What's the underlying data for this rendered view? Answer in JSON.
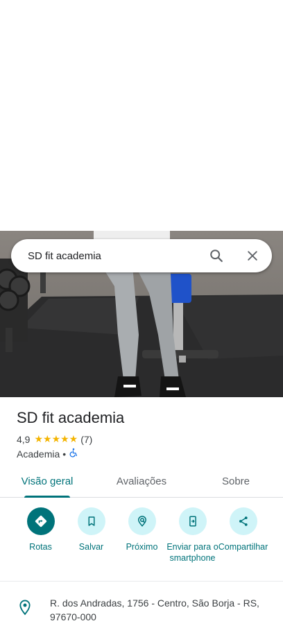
{
  "search": {
    "query": "SD fit academia"
  },
  "place": {
    "title": "SD fit academia",
    "rating": "4,9",
    "stars": "★★★★★",
    "review_count": "(7)",
    "category": "Academia",
    "separator": "•"
  },
  "tabs": [
    {
      "label": "Visão geral",
      "active": true
    },
    {
      "label": "Avaliações",
      "active": false
    },
    {
      "label": "Sobre",
      "active": false
    }
  ],
  "actions": [
    {
      "label": "Rotas",
      "icon": "directions-icon"
    },
    {
      "label": "Salvar",
      "icon": "bookmark-icon"
    },
    {
      "label": "Próximo",
      "icon": "nearby-icon"
    },
    {
      "label": "Enviar para o smartphone",
      "icon": "send-to-phone-icon"
    },
    {
      "label": "Compartilhar",
      "icon": "share-icon"
    }
  ],
  "address": {
    "text": "R. dos Andradas, 1756 - Centro, São Borja - RS, 97670-000"
  },
  "colors": {
    "accent": "#00737a",
    "action_bg": "#cff4f8",
    "star": "#f4b400"
  }
}
